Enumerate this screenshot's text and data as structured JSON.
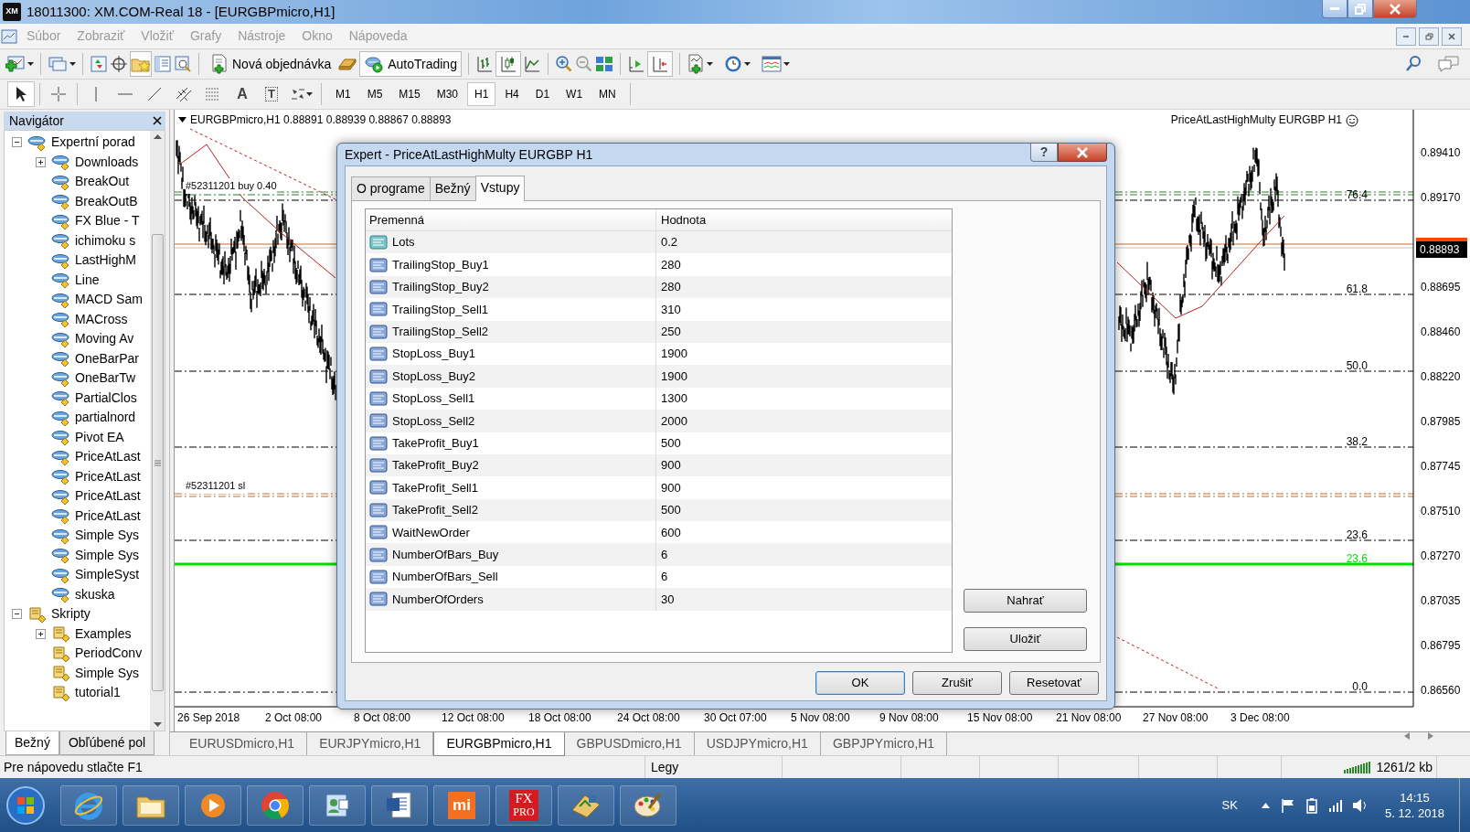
{
  "window": {
    "logo": "XM",
    "title": "18011300: XM.COM-Real 18 - [EURGBPmicro,H1]"
  },
  "menu": [
    {
      "label": "Súbor",
      "disabled": true
    },
    {
      "label": "Zobraziť",
      "disabled": true
    },
    {
      "label": "Vložiť",
      "disabled": true
    },
    {
      "label": "Grafy",
      "disabled": true
    },
    {
      "label": "Nástroje",
      "disabled": true
    },
    {
      "label": "Okno",
      "disabled": true
    },
    {
      "label": "Nápoveda",
      "disabled": true
    }
  ],
  "toolbar": {
    "order_button": "Nová objednávka",
    "autotrading_button": "AutoTrading"
  },
  "drawing_tools": [
    {
      "kind": "cursor",
      "selected": true
    },
    {
      "kind": "crosshair",
      "selected": false
    },
    {
      "kind": "vline",
      "selected": false
    },
    {
      "kind": "hline",
      "selected": false
    },
    {
      "kind": "trendline",
      "selected": false
    },
    {
      "kind": "channel",
      "selected": false
    },
    {
      "kind": "fibo",
      "selected": false
    },
    {
      "kind": "text",
      "glyph": "A",
      "selected": false
    },
    {
      "kind": "label",
      "glyph": "T",
      "selected": false
    },
    {
      "kind": "arrows",
      "selected": false
    }
  ],
  "timeframes": [
    {
      "label": "M1",
      "selected": false
    },
    {
      "label": "M5",
      "selected": false
    },
    {
      "label": "M15",
      "selected": false
    },
    {
      "label": "M30",
      "selected": false
    },
    {
      "label": "H1",
      "selected": true
    },
    {
      "label": "H4",
      "selected": false
    },
    {
      "label": "D1",
      "selected": false
    },
    {
      "label": "W1",
      "selected": false
    },
    {
      "label": "MN",
      "selected": false
    }
  ],
  "navigator": {
    "title": "Navigátor",
    "tree": [
      {
        "label": "Expertní porad",
        "kind": "expert",
        "expanded": true,
        "children": [
          {
            "label": "Downloads",
            "kind": "expert",
            "expanded": false
          },
          {
            "label": "BreakOut",
            "kind": "expert"
          },
          {
            "label": "BreakOutB",
            "kind": "expert"
          },
          {
            "label": "FX Blue - T",
            "kind": "expert"
          },
          {
            "label": "ichimoku s",
            "kind": "expert"
          },
          {
            "label": "LastHighM",
            "kind": "expert"
          },
          {
            "label": "Line",
            "kind": "expert"
          },
          {
            "label": "MACD Sam",
            "kind": "expert"
          },
          {
            "label": "MACross",
            "kind": "expert"
          },
          {
            "label": "Moving Av",
            "kind": "expert"
          },
          {
            "label": "OneBarPar",
            "kind": "expert"
          },
          {
            "label": "OneBarTw",
            "kind": "expert"
          },
          {
            "label": "PartialClos",
            "kind": "expert"
          },
          {
            "label": "partialnord",
            "kind": "expert"
          },
          {
            "label": "Pivot EA",
            "kind": "expert"
          },
          {
            "label": "PriceAtLast",
            "kind": "expert"
          },
          {
            "label": "PriceAtLast",
            "kind": "expert"
          },
          {
            "label": "PriceAtLast",
            "kind": "expert"
          },
          {
            "label": "PriceAtLast",
            "kind": "expert"
          },
          {
            "label": "Simple Sys",
            "kind": "expert"
          },
          {
            "label": "Simple Sys",
            "kind": "expert"
          },
          {
            "label": "SimpleSyst",
            "kind": "expert"
          },
          {
            "label": "skuska",
            "kind": "expert"
          }
        ]
      },
      {
        "label": "Skripty",
        "kind": "script",
        "expanded": true,
        "children": [
          {
            "label": "Examples",
            "kind": "script",
            "expanded": false
          },
          {
            "label": "PeriodConv",
            "kind": "script"
          },
          {
            "label": "Simple Sys",
            "kind": "script"
          },
          {
            "label": "tutorial1",
            "kind": "script"
          }
        ]
      }
    ],
    "tabs": [
      {
        "label": "Bežný",
        "selected": true
      },
      {
        "label": "Obľúbené pol",
        "selected": false
      }
    ]
  },
  "chart": {
    "symbol_info": "EURGBPmicro,H1  0.88891 0.88939 0.88867 0.88893",
    "expert_label": "PriceAtLastHighMulty EURGBP H1",
    "order_labels": [
      "#52311201 buy 0.40",
      "#52311201 sl"
    ],
    "levels": [
      {
        "label": "76.4",
        "color": "#000000"
      },
      {
        "label": "61.8",
        "color": "#000000"
      },
      {
        "label": "50.0",
        "color": "#000000"
      },
      {
        "label": "38.2",
        "color": "#000000"
      },
      {
        "label": "23.6",
        "color": "#000000"
      },
      {
        "label": "23.6",
        "color": "#00dd00"
      },
      {
        "label": "0.0",
        "color": "#000000"
      }
    ],
    "price_axis": [
      "0.89410",
      "0.89170",
      "0.88695",
      "0.88460",
      "0.88220",
      "0.87985",
      "0.87745",
      "0.87510",
      "0.87270",
      "0.87035",
      "0.86795",
      "0.86560"
    ],
    "current_price": "0.88893",
    "time_axis": [
      "26 Sep 2018",
      "2 Oct 08:00",
      "8 Oct 08:00",
      "12 Oct 08:00",
      "18 Oct 08:00",
      "24 Oct 08:00",
      "30 Oct 07:00",
      "5 Nov 08:00",
      "9 Nov 08:00",
      "15 Nov 08:00",
      "21 Nov 08:00",
      "27 Nov 08:00",
      "3 Dec 08:00"
    ]
  },
  "dialog": {
    "title": "Expert - PriceAtLastHighMulty EURGBP H1",
    "help_glyph": "?",
    "tabs": [
      {
        "label": "O programe",
        "selected": false
      },
      {
        "label": "Bežný",
        "selected": false
      },
      {
        "label": "Vstupy",
        "selected": true
      }
    ],
    "columns": [
      "Premenná",
      "Hodnota"
    ],
    "rows": [
      {
        "kind": "double",
        "name": "Lots",
        "value": "0.2"
      },
      {
        "kind": "int",
        "name": "TrailingStop_Buy1",
        "value": "280"
      },
      {
        "kind": "int",
        "name": "TrailingStop_Buy2",
        "value": "280"
      },
      {
        "kind": "int",
        "name": "TrailingStop_Sell1",
        "value": "310"
      },
      {
        "kind": "int",
        "name": "TrailingStop_Sell2",
        "value": "250"
      },
      {
        "kind": "int",
        "name": "StopLoss_Buy1",
        "value": "1900"
      },
      {
        "kind": "int",
        "name": "StopLoss_Buy2",
        "value": "1900"
      },
      {
        "kind": "int",
        "name": "StopLoss_Sell1",
        "value": "1300"
      },
      {
        "kind": "int",
        "name": "StopLoss_Sell2",
        "value": "2000"
      },
      {
        "kind": "int",
        "name": "TakeProfit_Buy1",
        "value": "500"
      },
      {
        "kind": "int",
        "name": "TakeProfit_Buy2",
        "value": "900"
      },
      {
        "kind": "int",
        "name": "TakeProfit_Sell1",
        "value": "900"
      },
      {
        "kind": "int",
        "name": "TakeProfit_Sell2",
        "value": "500"
      },
      {
        "kind": "int",
        "name": "WaitNewOrder",
        "value": "600"
      },
      {
        "kind": "int",
        "name": "NumberOfBars_Buy",
        "value": "6"
      },
      {
        "kind": "int",
        "name": "NumberOfBars_Sell",
        "value": "6"
      },
      {
        "kind": "int",
        "name": "NumberOfOrders",
        "value": "30"
      }
    ],
    "side_buttons": [
      "Nahrať",
      "Uložiť"
    ],
    "buttons": [
      {
        "label": "OK",
        "default": true
      },
      {
        "label": "Zrušiť",
        "default": false
      },
      {
        "label": "Resetovať",
        "default": false
      }
    ]
  },
  "chart_tabs": [
    {
      "label": "EURUSDmicro,H1",
      "selected": false
    },
    {
      "label": "EURJPYmicro,H1",
      "selected": false
    },
    {
      "label": "EURGBPmicro,H1",
      "selected": true
    },
    {
      "label": "GBPUSDmicro,H1",
      "selected": false
    },
    {
      "label": "USDJPYmicro,H1",
      "selected": false
    },
    {
      "label": "GBPJPYmicro,H1",
      "selected": false
    }
  ],
  "status_bar": {
    "help": "Pre nápovedu stlačte F1",
    "profile": "Legy",
    "traffic": "1261/2 kb"
  },
  "taskbar": {
    "apps": [
      {
        "kind": "ie"
      },
      {
        "kind": "folder"
      },
      {
        "kind": "media"
      },
      {
        "kind": "chrome"
      },
      {
        "kind": "contacts"
      },
      {
        "kind": "word"
      },
      {
        "kind": "mi",
        "glyph": "mi"
      },
      {
        "kind": "fxpro",
        "glyph": "FX",
        "glyph2": "PRO"
      },
      {
        "kind": "terminal"
      },
      {
        "kind": "paint"
      }
    ],
    "language": "SK",
    "time": "14:15",
    "date": "5. 12. 2018"
  }
}
